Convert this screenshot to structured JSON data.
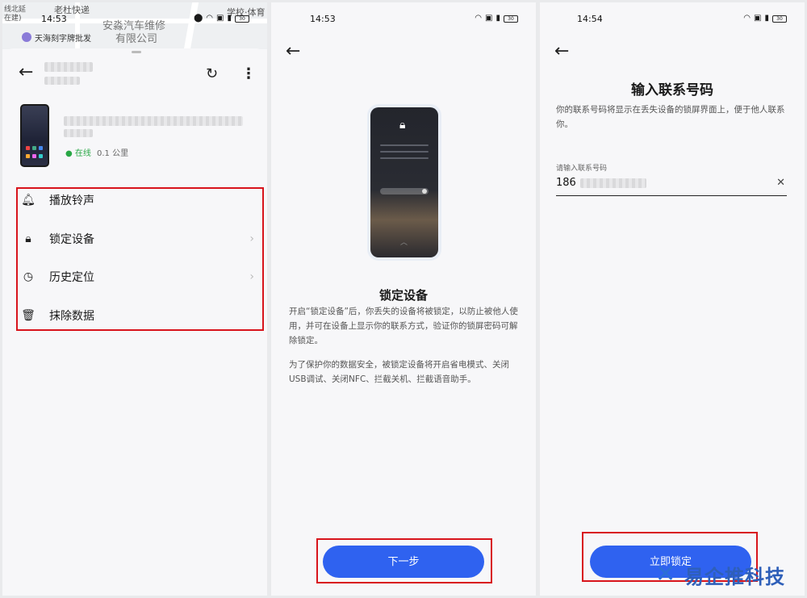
{
  "panel1": {
    "map": {
      "labels": [
        "线北延",
        "在建)",
        "老杜快递",
        "安淼汽车维修",
        "有限公司",
        "学校·体育",
        "天海刻字牌批发"
      ]
    },
    "status": {
      "time": "14:53"
    },
    "device": {
      "online": "在线",
      "distance": "0.1 公里"
    },
    "menu": [
      {
        "label": "播放铃声",
        "icon": "bell-icon"
      },
      {
        "label": "锁定设备",
        "icon": "lock-icon"
      },
      {
        "label": "历史定位",
        "icon": "location-history-icon"
      },
      {
        "label": "抹除数据",
        "icon": "trash-icon"
      }
    ]
  },
  "panel2": {
    "status": {
      "time": "14:53"
    },
    "title": "锁定设备",
    "para1": "开启“锁定设备”后，你丢失的设备将被锁定，以防止被他人使用，并可在设备上显示你的联系方式，验证你的锁屏密码可解除锁定。",
    "para2": "为了保护你的数据安全，被锁定设备将开启省电模式、关闭USB调试、关闭NFC、拦截关机、拦截语音助手。",
    "next_label": "下一步"
  },
  "panel3": {
    "status": {
      "time": "14:54"
    },
    "title": "输入联系号码",
    "desc": "你的联系号码将显示在丢失设备的锁屏界面上，便于他人联系你。",
    "field_label": "请输入联系号码",
    "field_value": "186",
    "lock_label": "立即锁定"
  },
  "status_bar": {
    "battery": "30"
  },
  "watermark": "易企推科技",
  "colors": {
    "accent": "#2f62f0",
    "highlight_border": "#d8141c",
    "online": "#28a745"
  }
}
